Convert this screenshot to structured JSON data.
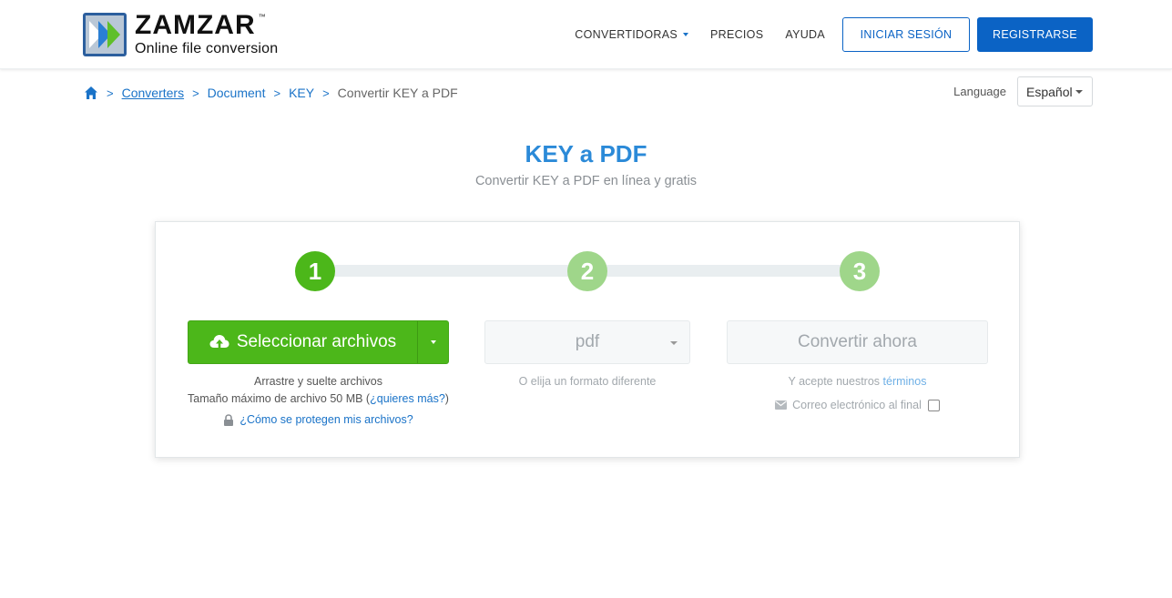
{
  "header": {
    "brand": "ZAMZAR",
    "trademark": "™",
    "tagline": "Online file conversion",
    "nav": {
      "converters": "CONVERTIDORAS",
      "pricing": "PRECIOS",
      "help": "AYUDA",
      "login": "INICIAR SESIÓN",
      "register": "REGISTRARSE"
    }
  },
  "breadcrumb": {
    "separator": ">",
    "items": [
      "Converters",
      "Document",
      "KEY"
    ],
    "current": "Convertir KEY a PDF"
  },
  "language": {
    "label": "Language",
    "selected": "Español"
  },
  "page": {
    "title": "KEY a PDF",
    "subtitle": "Convertir KEY a PDF en línea y gratis"
  },
  "steps": {
    "labels": [
      "1",
      "2",
      "3"
    ],
    "select_files": "Seleccionar archivos",
    "drag_drop": "Arrastre y suelte archivos",
    "max_size": "Tamaño máximo de archivo 50 MB (",
    "want_more": "¿quieres más?",
    "max_size_end": ")",
    "protect_link": "¿Cómo se protegen mis archivos?",
    "format_value": "pdf",
    "format_hint": "O elija un formato diferente",
    "convert_now": "Convertir ahora",
    "terms_prefix": "Y acepte nuestros ",
    "terms_link": "términos",
    "email_label": "Correo electrónico al final"
  },
  "colors": {
    "primary_blue": "#0b63c5",
    "title_blue": "#2b8ad8",
    "green": "#4cb71a",
    "light_green": "#9fd68a"
  }
}
